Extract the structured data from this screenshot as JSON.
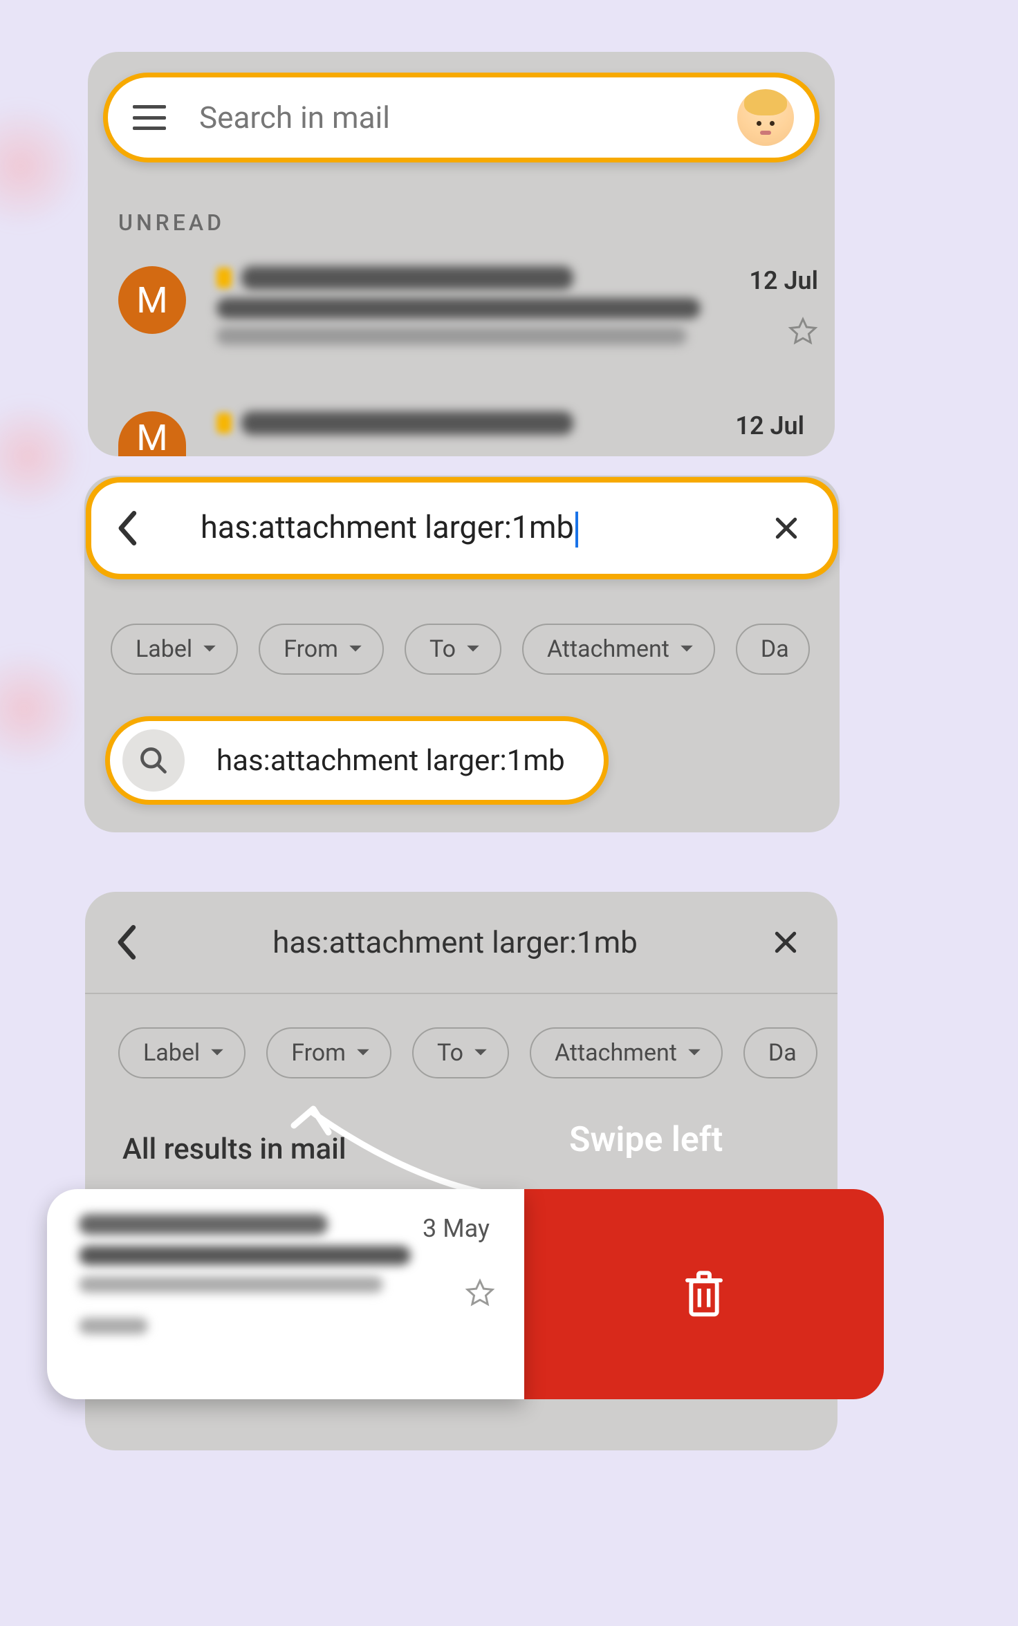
{
  "panel1": {
    "search_placeholder": "Search in mail",
    "section_label": "UNREAD",
    "rows": [
      {
        "avatar_letter": "M",
        "date": "12 Jul"
      },
      {
        "avatar_letter": "M",
        "date": "12 Jul"
      }
    ]
  },
  "panel2": {
    "query": "has:attachment larger:1mb",
    "chips": [
      "Label",
      "From",
      "To",
      "Attachment",
      "Da"
    ],
    "suggestion": "has:attachment larger:1mb"
  },
  "panel3": {
    "query": "has:attachment larger:1mb",
    "chips": [
      "Label",
      "From",
      "To",
      "Attachment",
      "Da"
    ],
    "results_label": "All results in mail",
    "swipe_hint": "Swipe left",
    "card_date": "3 May"
  }
}
